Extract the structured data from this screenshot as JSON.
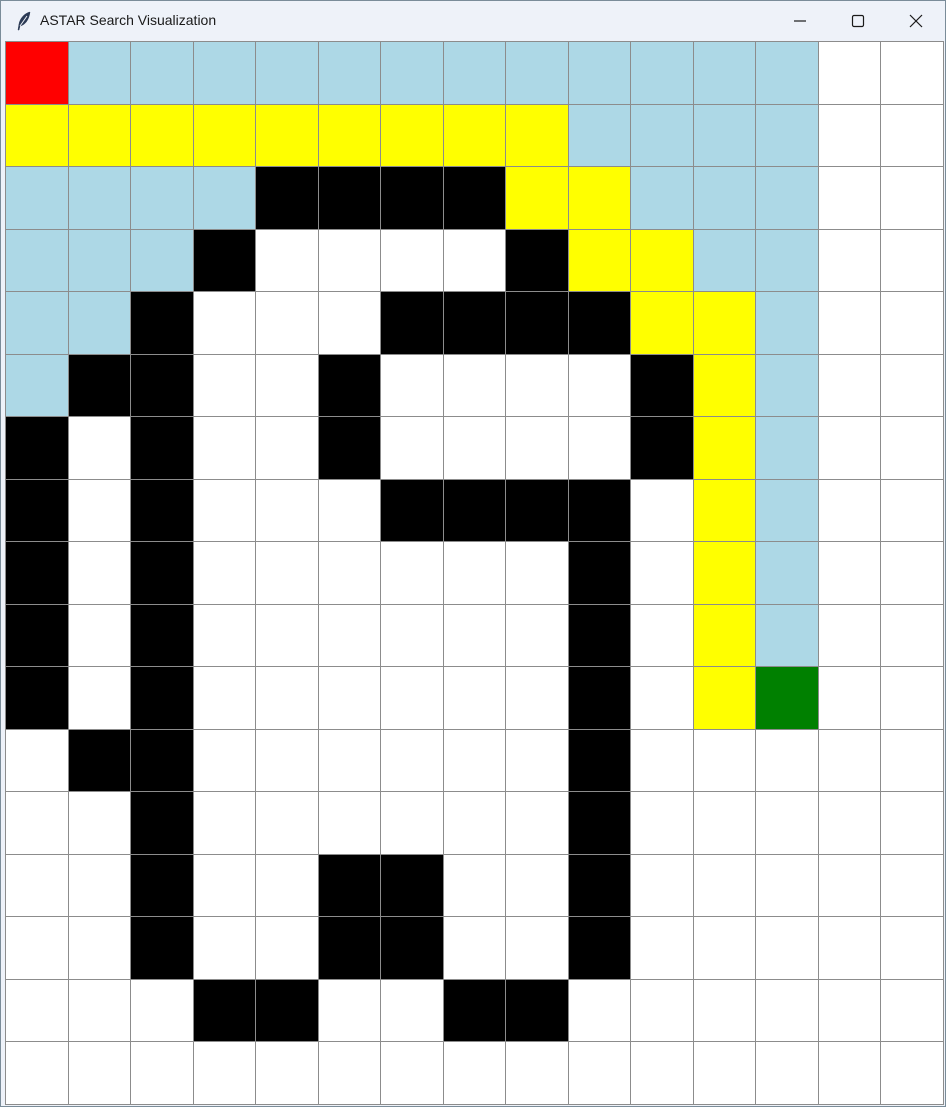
{
  "window": {
    "title": "ASTAR Search Visualization",
    "app_icon": "feather-icon",
    "controls": {
      "minimize_icon": "minimize-icon",
      "maximize_icon": "maximize-icon",
      "close_icon": "close-icon"
    }
  },
  "grid": {
    "rows": 17,
    "cols": 15,
    "legend_colors": {
      "S": "#ff0000",
      "G": "#008000",
      "P": "#ffff00",
      "V": "#add8e6",
      "W": "#000000",
      ".": "#ffffff"
    },
    "cells": [
      "SVVVVVVVVVVVV..",
      "PPPPPPPPPVVVV..",
      "VVVVWWWWPPVVV..",
      "VVVW....WPPVV..",
      "VVW...WWWWPPV..",
      "VWW..W....WPV..",
      "W.W..W....WPV..",
      "W.W...WWWW.PV..",
      "W.W......W.PV..",
      "W.W......W.PV..",
      "W.W......W.PG..",
      ".WW......W.....",
      "..W......W.....",
      "..W..WW..W.....",
      "..W..WW..W.....",
      "...WW..WW......",
      "..............."
    ]
  }
}
